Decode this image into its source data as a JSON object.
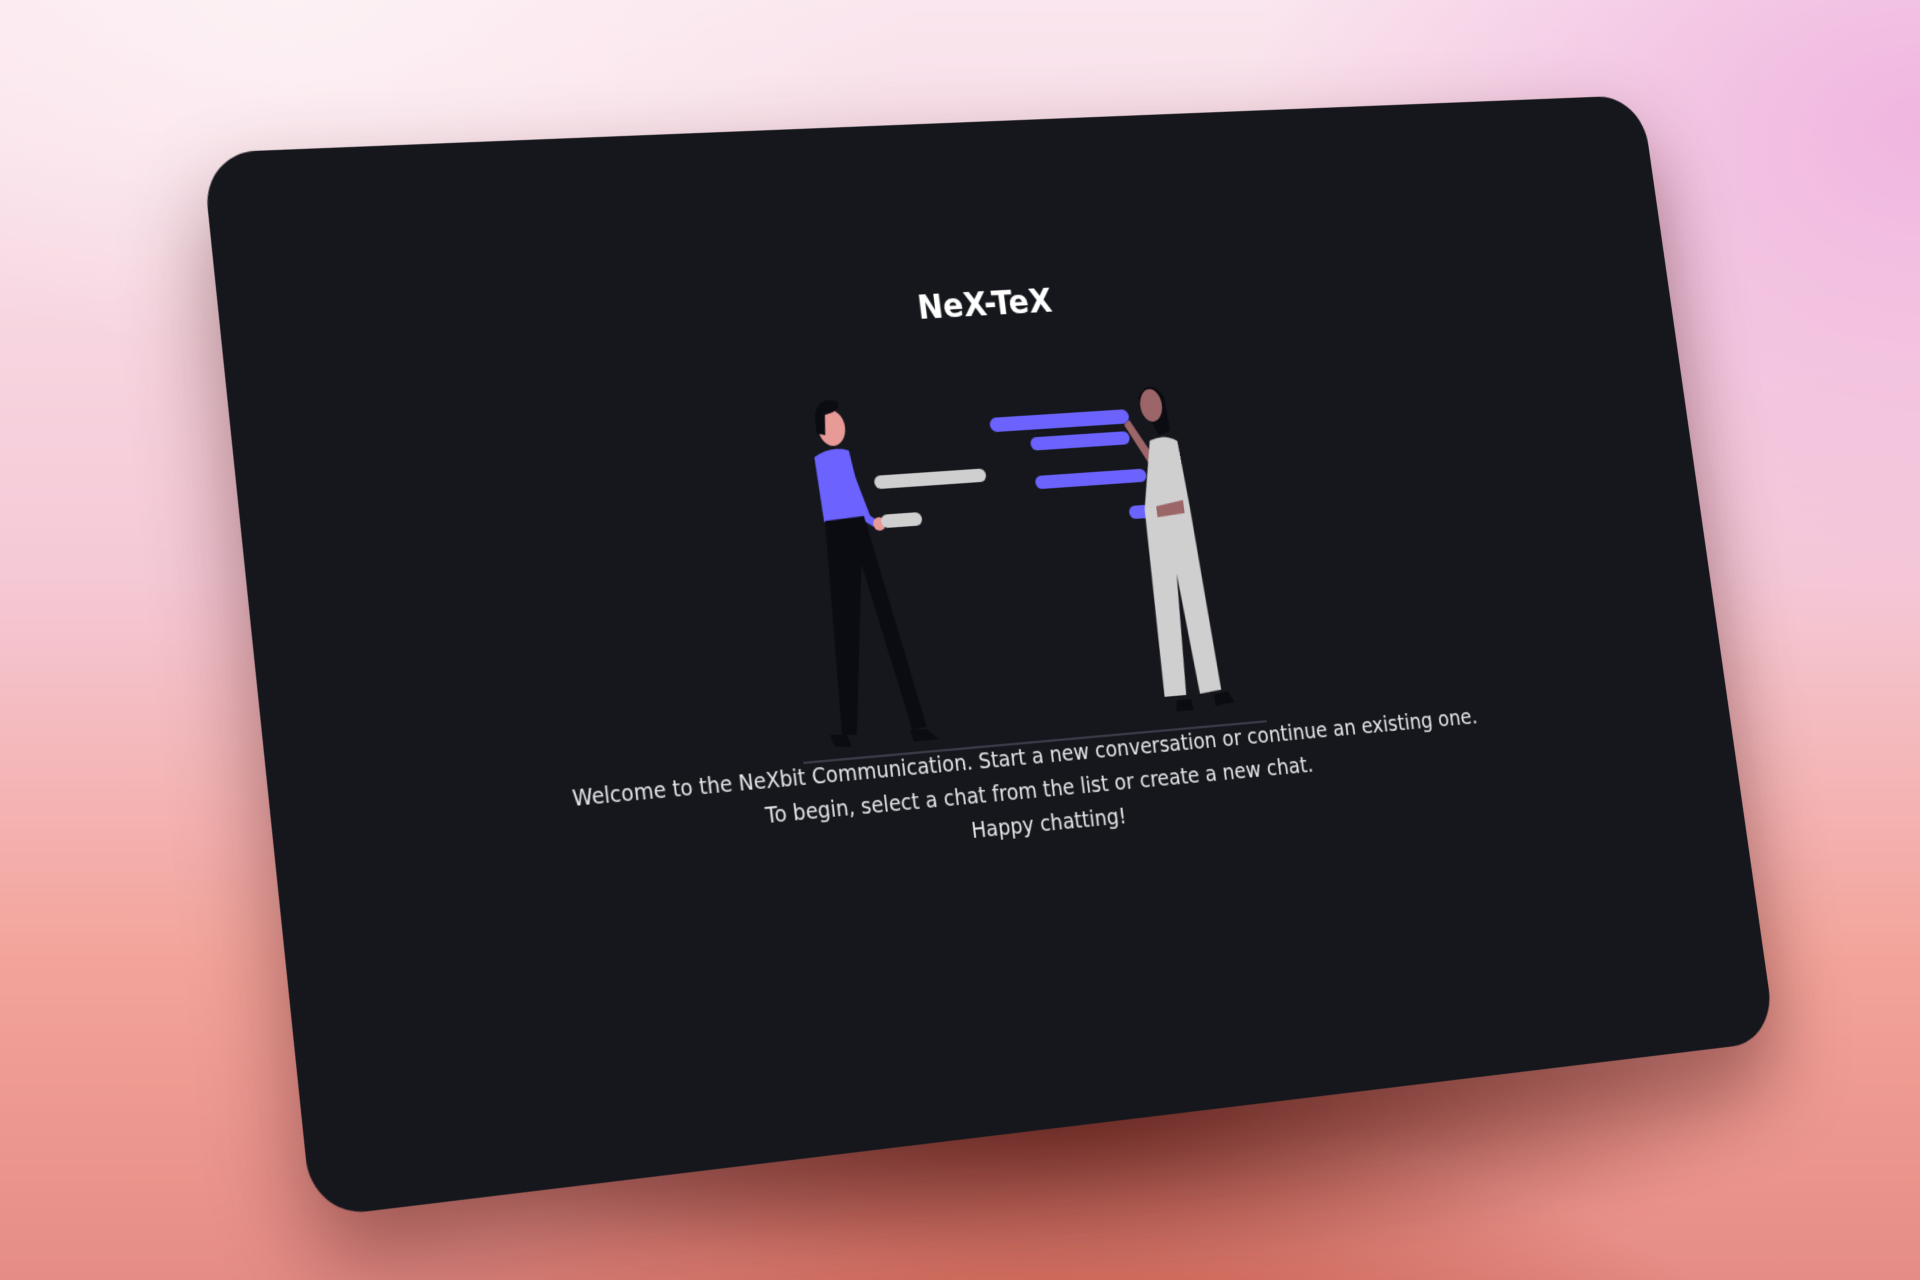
{
  "app": {
    "title": "NeX-TeX"
  },
  "welcome": {
    "line1": "Welcome to the NeXbit Communication. Start a new conversation or continue an existing one.",
    "line2": "To begin, select a chat from the list or create a new chat.",
    "line3": "Happy chatting!"
  },
  "colors": {
    "card_bg": "#15171c",
    "accent": "#6c63ff",
    "bubble_gray": "#cfcfcf"
  },
  "illustration": "two-people-exchanging-chat-bubbles"
}
